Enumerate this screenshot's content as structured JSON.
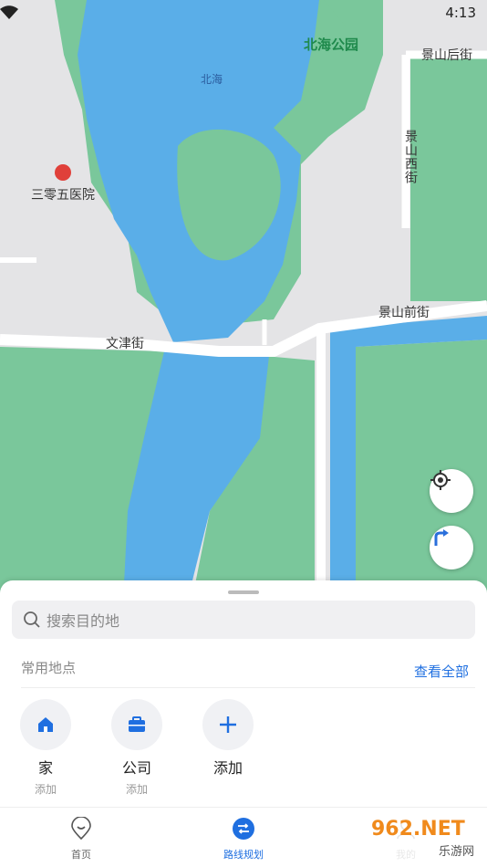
{
  "status": {
    "time": "4:13"
  },
  "map": {
    "labels": {
      "beihai_park": "北海公园",
      "beihai": "北海",
      "jingshan_hou": "景山后街",
      "jingshan_xi": "景山西街",
      "hospital": "三零五医院",
      "jingshan_qian": "景山前街",
      "wenjin": "文津街"
    }
  },
  "search": {
    "placeholder": "搜索目的地"
  },
  "places": {
    "title": "常用地点",
    "view_all": "查看全部",
    "items": [
      {
        "name": "家",
        "sub": "添加"
      },
      {
        "name": "公司",
        "sub": "添加"
      },
      {
        "name": "添加",
        "sub": ""
      }
    ]
  },
  "nav": {
    "items": [
      {
        "label": "首页"
      },
      {
        "label": "路线规划"
      },
      {
        "label": "我的"
      }
    ]
  },
  "watermark": {
    "text": "962.NET",
    "sub": "乐游网"
  },
  "colors": {
    "accent": "#1f6fe0",
    "water": "#5aaee8",
    "park": "#77c89a"
  }
}
